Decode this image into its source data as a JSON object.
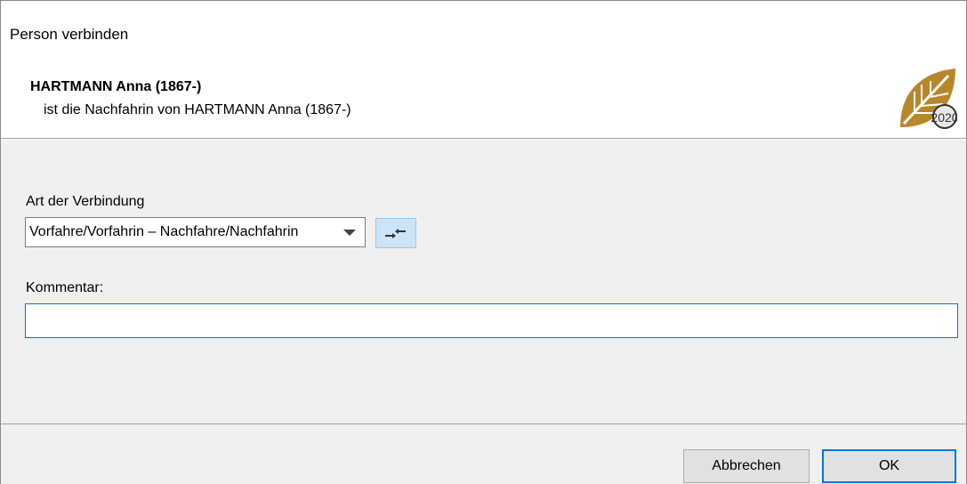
{
  "window": {
    "title": "Person verbinden"
  },
  "header": {
    "name": "HARTMANN Anna (1867-)",
    "description": "ist die Nachfahrin von HARTMANN Anna (1867-)",
    "logo_icon": "leaf-2020-logo-icon",
    "logo_text": "2020"
  },
  "form": {
    "connection_label": "Art der Verbindung",
    "connection_value": "Vorfahre/Vorfahrin – Nachfahre/Nachfahrin",
    "swap_icon": "swap-arrows-icon",
    "comment_label": "Kommentar:",
    "comment_value": ""
  },
  "buttons": {
    "cancel_label": "Abbrechen",
    "ok_label": "OK"
  },
  "colors": {
    "accent": "#0078d7",
    "logo_gold": "#b8862b",
    "panel_bg": "#f0f0f0"
  }
}
